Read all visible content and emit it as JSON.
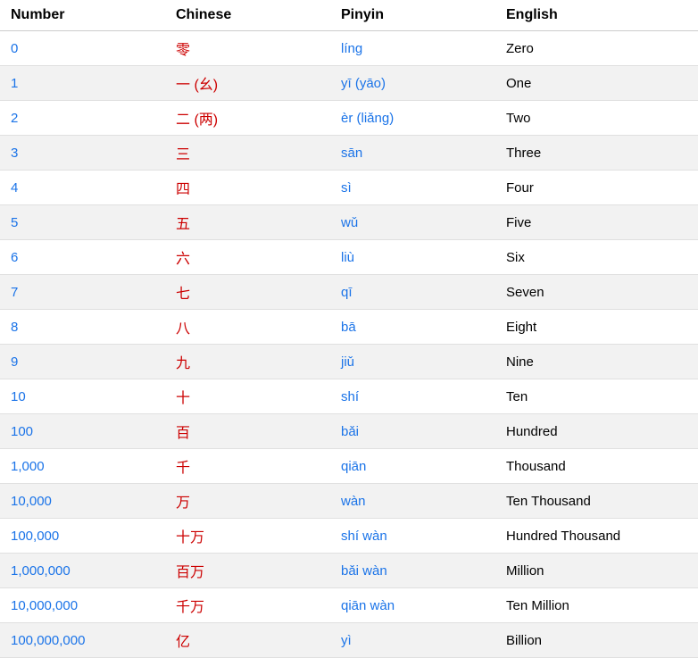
{
  "table": {
    "headers": [
      "Number",
      "Chinese",
      "Pinyin",
      "English"
    ],
    "rows": [
      {
        "number": "0",
        "chinese": "零",
        "pinyin": "líng",
        "english": "Zero"
      },
      {
        "number": "1",
        "chinese": "一 (幺)",
        "pinyin": "yī  (yāo)",
        "english": "One"
      },
      {
        "number": "2",
        "chinese": "二 (两)",
        "pinyin": "èr (liǎng)",
        "english": "Two"
      },
      {
        "number": "3",
        "chinese": "三",
        "pinyin": "sān",
        "english": "Three"
      },
      {
        "number": "4",
        "chinese": "四",
        "pinyin": "sì",
        "english": "Four"
      },
      {
        "number": "5",
        "chinese": "五",
        "pinyin": "wǔ",
        "english": "Five"
      },
      {
        "number": "6",
        "chinese": "六",
        "pinyin": "liù",
        "english": "Six"
      },
      {
        "number": "7",
        "chinese": "七",
        "pinyin": "qī",
        "english": "Seven"
      },
      {
        "number": "8",
        "chinese": "八",
        "pinyin": "bā",
        "english": "Eight"
      },
      {
        "number": "9",
        "chinese": "九",
        "pinyin": "jiǔ",
        "english": "Nine"
      },
      {
        "number": "10",
        "chinese": "十",
        "pinyin": "shí",
        "english": "Ten"
      },
      {
        "number": "100",
        "chinese": "百",
        "pinyin": "bǎi",
        "english": "Hundred"
      },
      {
        "number": "1,000",
        "chinese": "千",
        "pinyin": "qiān",
        "english": "Thousand"
      },
      {
        "number": "10,000",
        "chinese": "万",
        "pinyin": "wàn",
        "english": "Ten Thousand"
      },
      {
        "number": "100,000",
        "chinese": "十万",
        "pinyin": "shí wàn",
        "english": "Hundred Thousand"
      },
      {
        "number": "1,000,000",
        "chinese": "百万",
        "pinyin": "bǎi wàn",
        "english": "Million"
      },
      {
        "number": "10,000,000",
        "chinese": "千万",
        "pinyin": "qiān  wàn",
        "english": "Ten Million"
      },
      {
        "number": "100,000,000",
        "chinese": "亿",
        "pinyin": "yì",
        "english": "Billion"
      }
    ]
  }
}
